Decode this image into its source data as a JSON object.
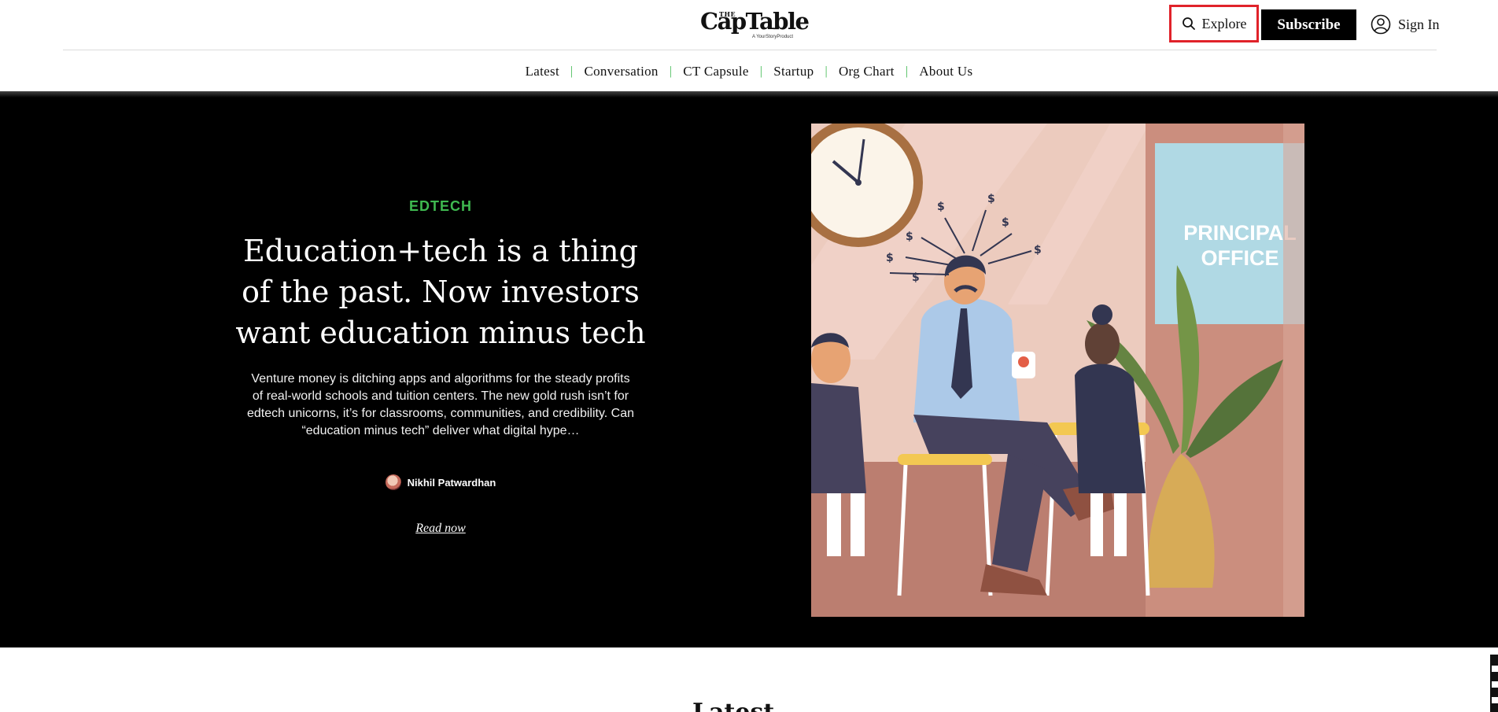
{
  "header": {
    "logo": {
      "the": "THE",
      "name_part1": "Cap",
      "name_part2": "Table",
      "subtitle": "A YourStoryProduct"
    },
    "explore_label": "Explore",
    "subscribe_label": "Subscribe",
    "signin_label": "Sign In"
  },
  "nav": {
    "items": [
      "Latest",
      "Conversation",
      "CT Capsule",
      "Startup",
      "Org Chart",
      "About Us"
    ]
  },
  "hero": {
    "category": "EDTECH",
    "headline": "Education+tech is a thing of the past. Now investors want education minus tech",
    "excerpt": "Venture money is ditching apps and algorithms for the steady profits of real-world schools and tuition centers. The new gold rush isn’t for edtech unicorns, it’s for classrooms, communities, and credibility. Can “education minus tech” deliver what digital hype…",
    "author": "Nikhil Patwardhan",
    "read_now": "Read now",
    "image_sign": "PRINCIPAL OFFICE",
    "image_sign_line1": "PRINCIPAL",
    "image_sign_line2": "OFFICE"
  },
  "latest_section": {
    "heading": "Latest"
  },
  "colors": {
    "accent": "#3fb950",
    "highlight_border": "#e0222a",
    "hero_bg": "#000000"
  }
}
